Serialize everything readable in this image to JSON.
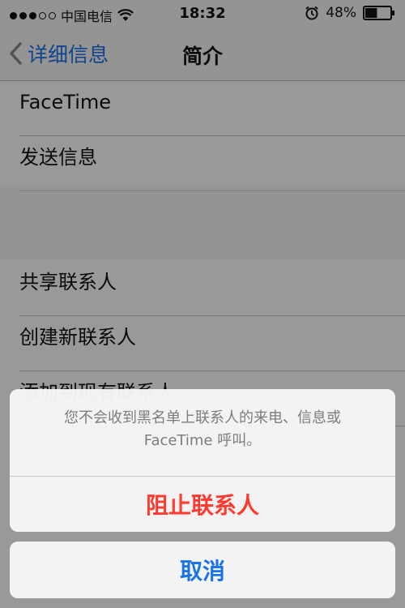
{
  "status_bar": {
    "carrier": "中国电信",
    "time": "18:32",
    "battery": "48%",
    "signal_bars_filled": 3,
    "signal_bars_total": 5,
    "battery_level": 0.48
  },
  "nav": {
    "back_label": "详细信息",
    "title": "简介"
  },
  "list": {
    "items": [
      "FaceTime",
      "发送信息",
      "共享联系人",
      "创建新联系人",
      "添加到现有联系人"
    ]
  },
  "action_sheet": {
    "message_line1": "您不会收到黑名单上联系人的来电、信息或",
    "message_line2": "FaceTime 呼叫。",
    "block_label": "阻止联系人",
    "cancel_label": "取消"
  },
  "colors": {
    "accent": "#1a73e8",
    "destructive": "#ff3b30",
    "message_text": "#7d7d7d"
  },
  "icons": [
    "wifi-icon",
    "alarm-icon",
    "battery-icon",
    "chevron-left-icon"
  ]
}
